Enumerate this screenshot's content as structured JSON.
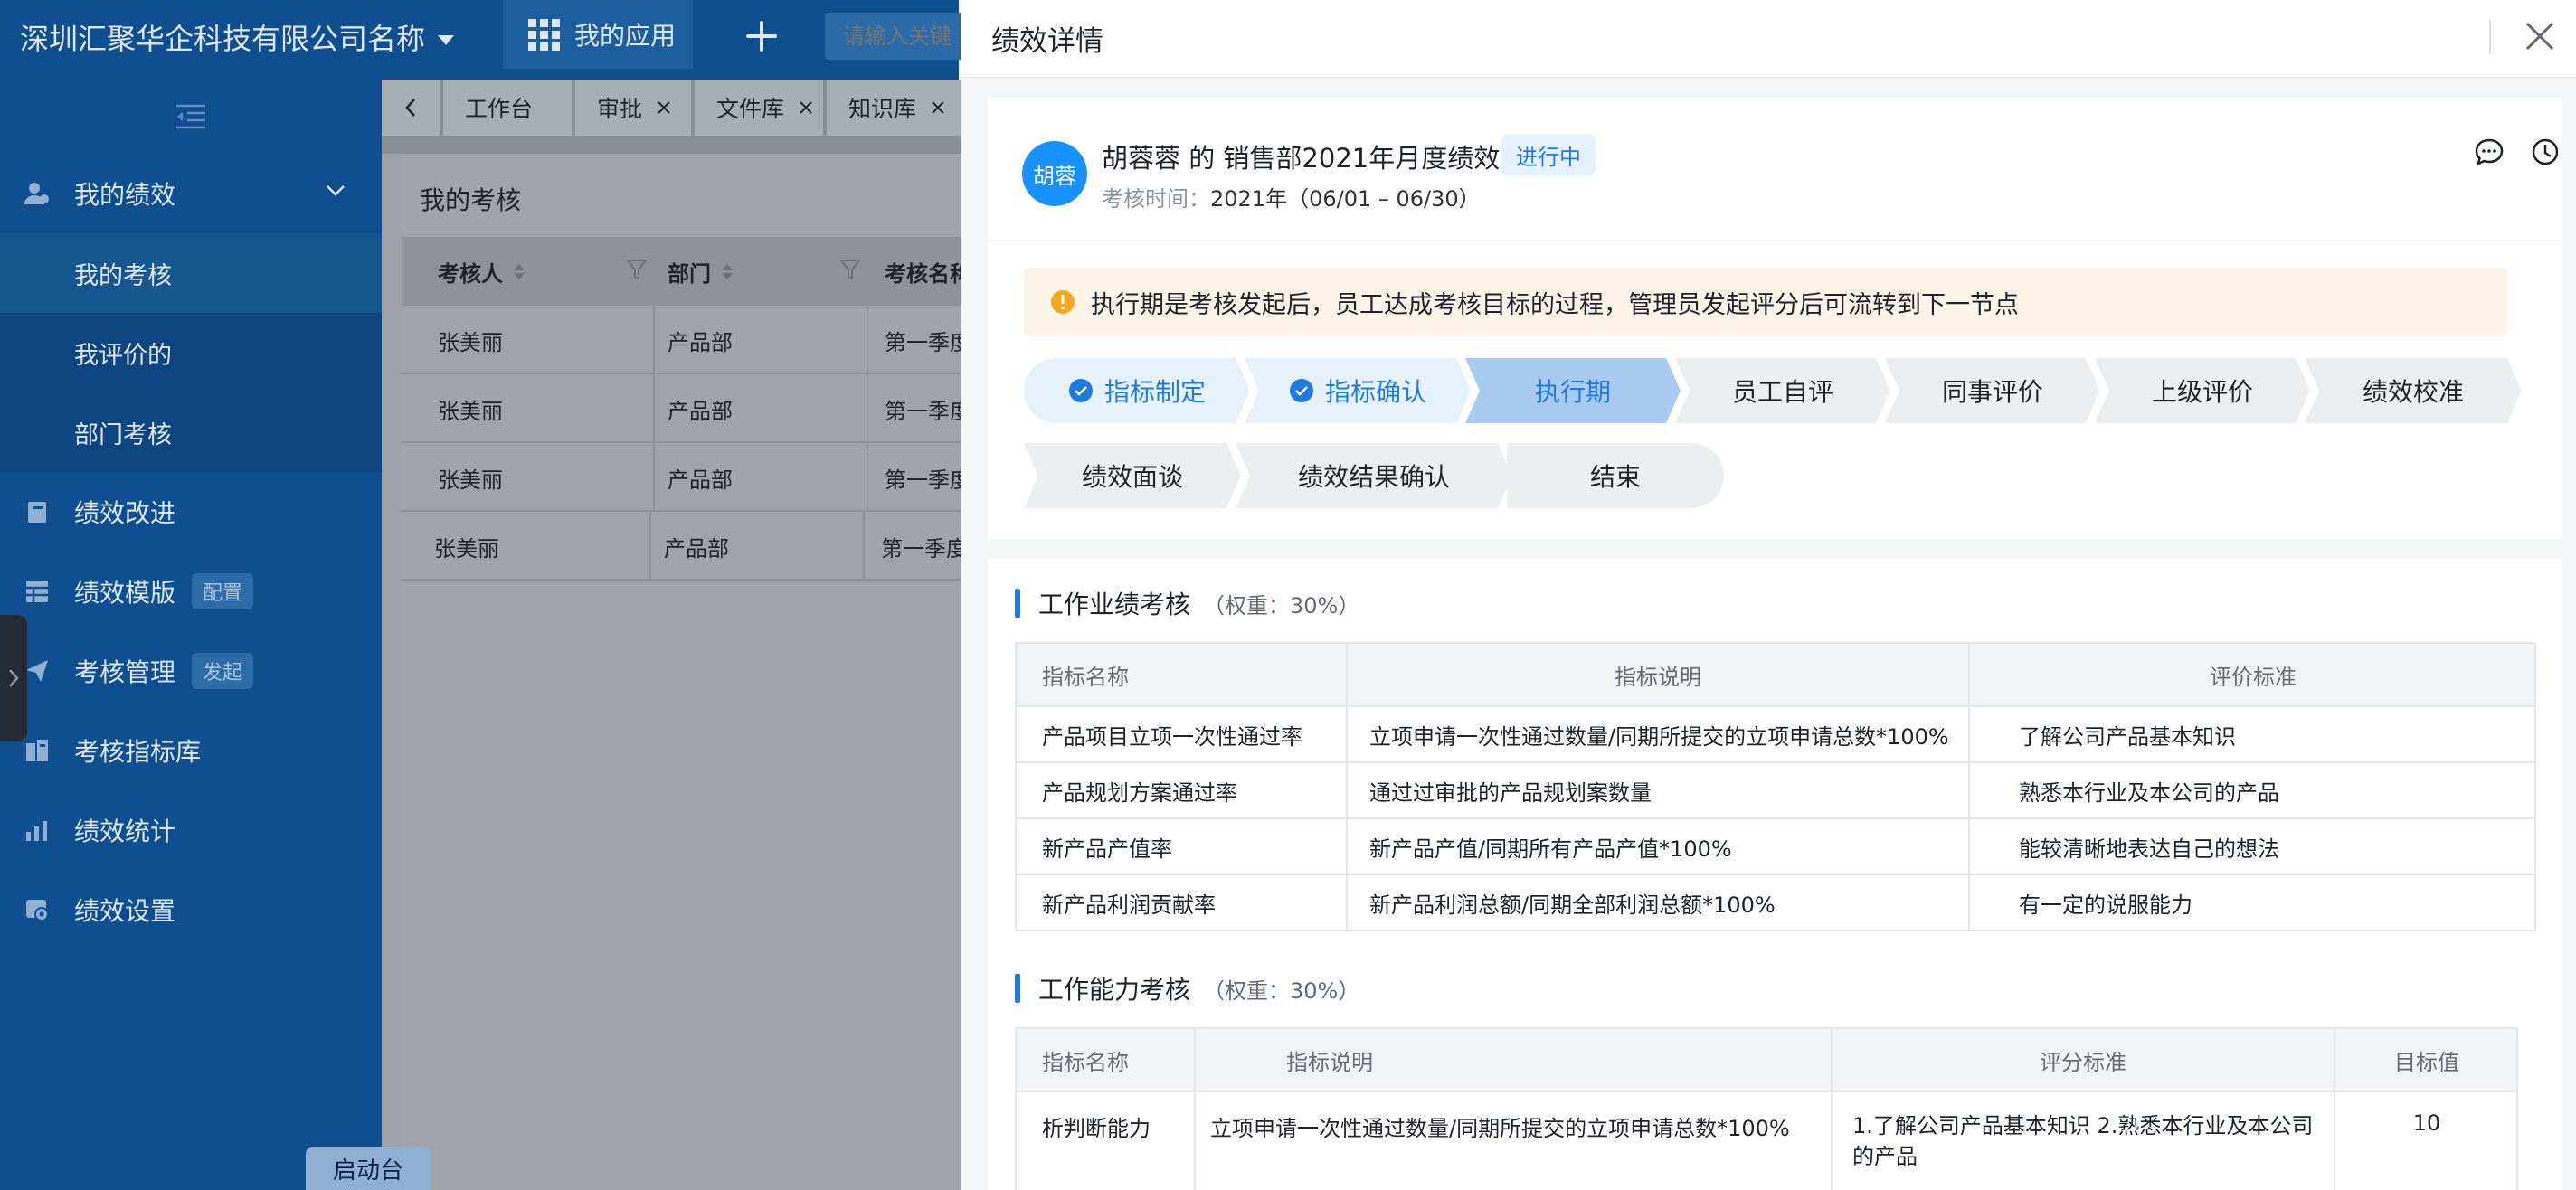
{
  "app": {
    "company_name": "深圳汇聚华企科技有限公司名称",
    "apps_label": "我的应用",
    "search_placeholder": "请输入关键",
    "launch_label": "启动台"
  },
  "sidebar": {
    "groups": [
      {
        "label": "我的绩效",
        "icon": "user-group-icon",
        "expanded": true,
        "children": [
          {
            "label": "我的考核",
            "active": true
          },
          {
            "label": "我评价的",
            "active": false
          },
          {
            "label": "部门考核",
            "active": false
          }
        ]
      },
      {
        "label": "绩效改进",
        "icon": "book-icon"
      },
      {
        "label": "绩效模版",
        "icon": "table-icon",
        "tag": "配置"
      },
      {
        "label": "考核管理",
        "icon": "send-icon",
        "tag": "发起"
      },
      {
        "label": "考核指标库",
        "icon": "database-icon"
      },
      {
        "label": "绩效统计",
        "icon": "stats-icon"
      },
      {
        "label": "绩效设置",
        "icon": "settings-icon"
      }
    ]
  },
  "tabs": [
    {
      "label": "工作台",
      "closable": false
    },
    {
      "label": "审批",
      "closable": true
    },
    {
      "label": "文件库",
      "closable": true
    },
    {
      "label": "知识库",
      "closable": true
    }
  ],
  "background_page": {
    "title": "我的考核",
    "columns": [
      "考核人",
      "部门",
      "考核名称"
    ],
    "rows": [
      [
        "张美丽",
        "产品部",
        "第一季度"
      ],
      [
        "张美丽",
        "产品部",
        "第一季度"
      ],
      [
        "张美丽",
        "产品部",
        "第一季度"
      ],
      [
        "张美丽",
        "产品部",
        "第一季度"
      ]
    ]
  },
  "drawer": {
    "title": "绩效详情",
    "avatar_text": "胡蓉",
    "plan_title": "胡蓉蓉 的 销售部2021年月度绩效",
    "status": "进行中",
    "status_color": "#1f7ae0",
    "time_label": "考核时间：",
    "time_value": "2021年（06/01 – 06/30）",
    "notice": "执行期是考核发起后，员工达成考核目标的过程，管理员发起评分后可流转到下一节点",
    "steps": [
      {
        "label": "指标制定",
        "state": "done"
      },
      {
        "label": "指标确认",
        "state": "done"
      },
      {
        "label": "执行期",
        "state": "current"
      },
      {
        "label": "员工自评",
        "state": "pending"
      },
      {
        "label": "同事评价",
        "state": "pending"
      },
      {
        "label": "上级评价",
        "state": "pending"
      },
      {
        "label": "绩效校准",
        "state": "pending"
      },
      {
        "label": "绩效面谈",
        "state": "pending"
      },
      {
        "label": "绩效结果确认",
        "state": "pending"
      },
      {
        "label": "结束",
        "state": "pending"
      }
    ],
    "sections": [
      {
        "title": "工作业绩考核",
        "weight": "（权重：30%）",
        "columns": [
          "指标名称",
          "指标说明",
          "评价标准"
        ],
        "rows": [
          [
            "产品项目立项一次性通过率",
            "立项申请一次性通过数量/同期所提交的立项申请总数*100%",
            "了解公司产品基本知识"
          ],
          [
            "产品规划方案通过率",
            "通过过审批的产品规划案数量",
            "熟悉本行业及本公司的产品"
          ],
          [
            "新产品产值率",
            "新产品产值/同期所有产品产值*100%",
            "能较清晰地表达自己的想法"
          ],
          [
            "新产品利润贡献率",
            "新产品利润总额/同期全部利润总额*100%",
            "有一定的说服能力"
          ]
        ]
      },
      {
        "title": "工作能力考核",
        "weight": "（权重：30%）",
        "columns": [
          "指标名称",
          "指标说明",
          "评分标准",
          "目标值"
        ],
        "rows": [
          [
            "析判断能力",
            "立项申请一次性通过数量/同期所提交的立项申请总数*100%",
            "1.了解公司产品基本知识 2.熟悉本行业及本公司的产品",
            "10"
          ]
        ]
      }
    ]
  }
}
